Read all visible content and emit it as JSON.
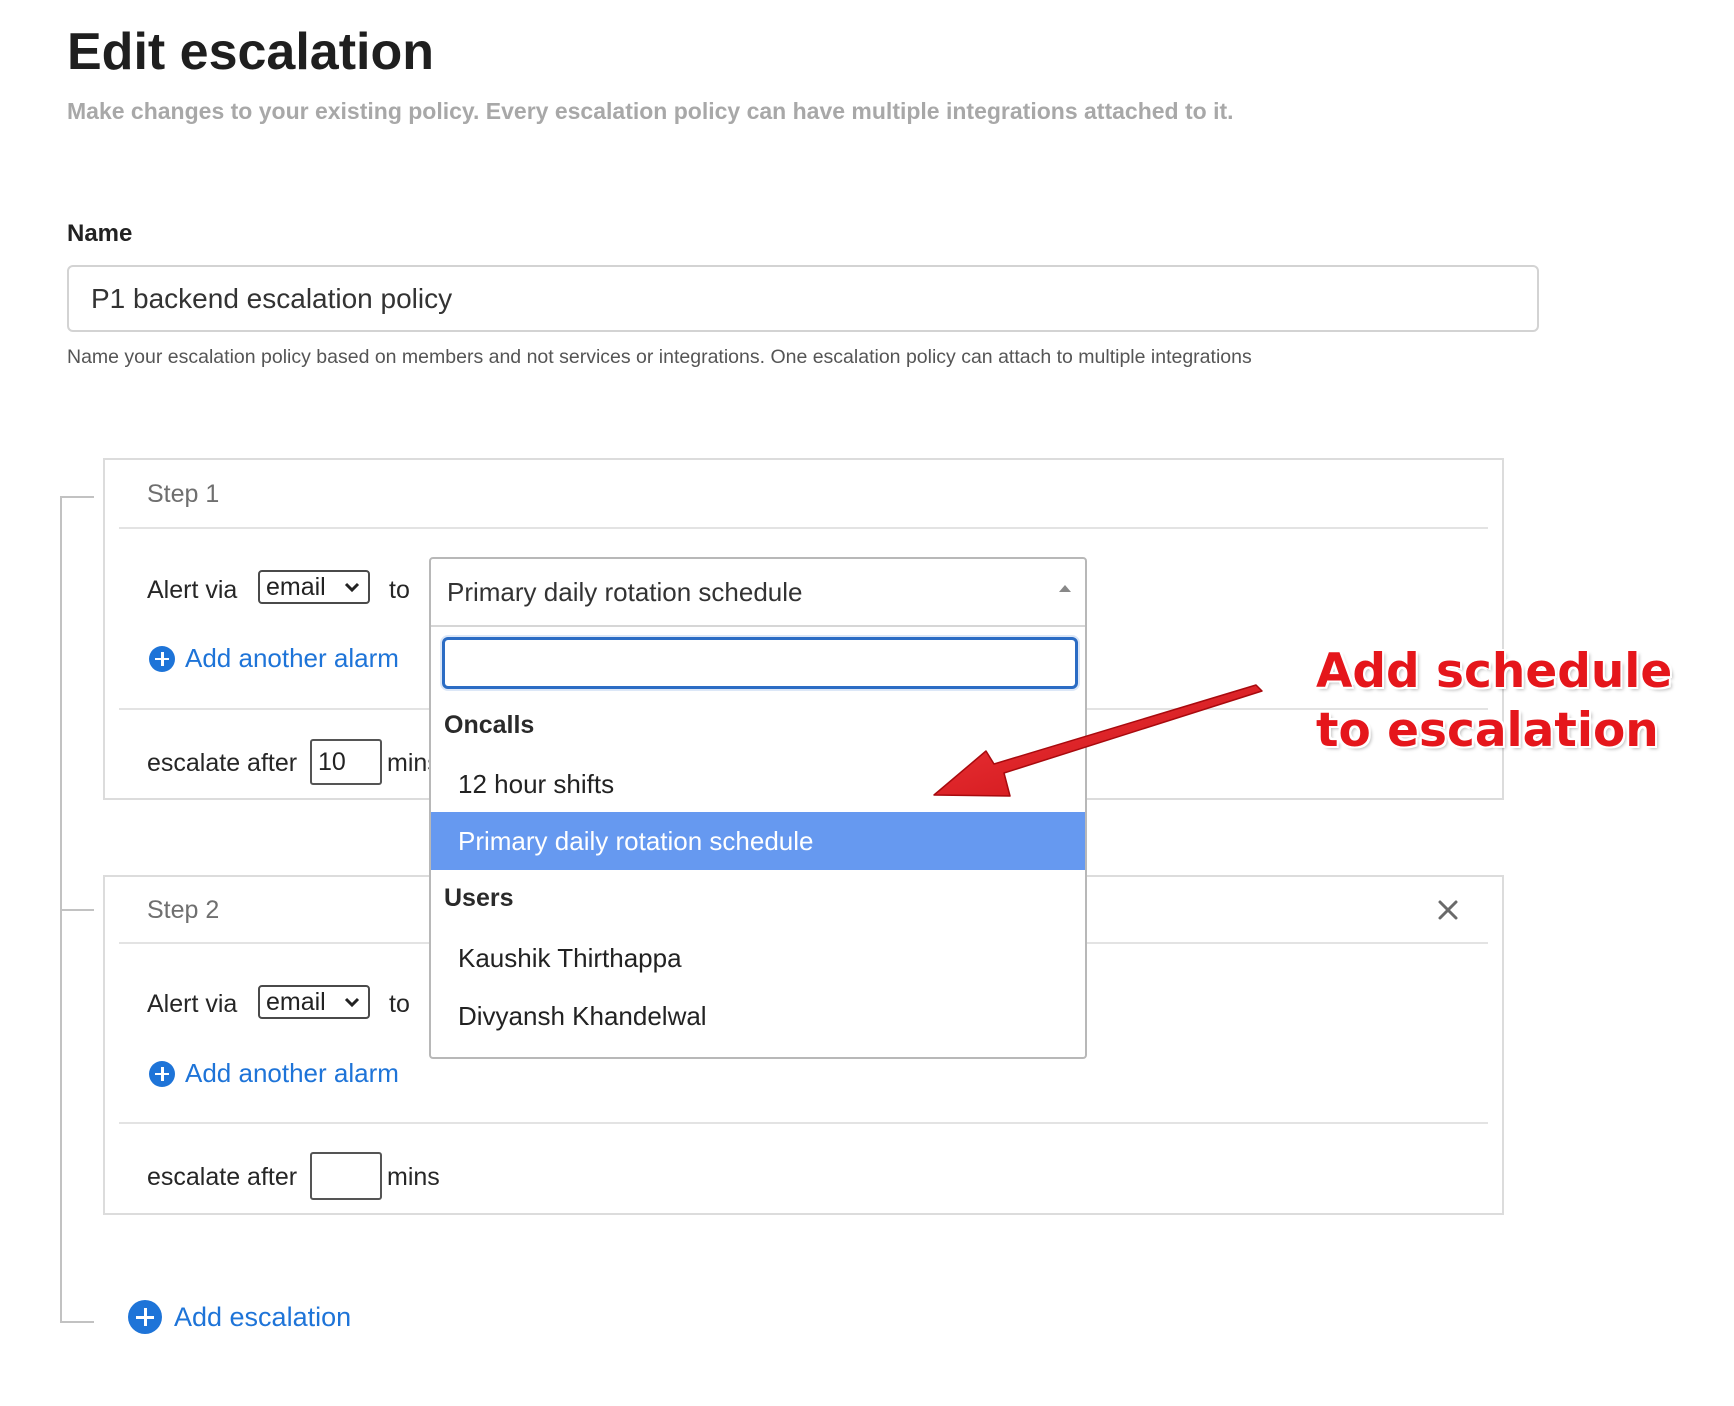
{
  "header": {
    "title": "Edit escalation",
    "subtitle": "Make changes to your existing policy. Every escalation policy can have multiple integrations attached to it."
  },
  "name_field": {
    "label": "Name",
    "value": "P1 backend escalation policy",
    "help": "Name your escalation policy based on members and not services or integrations. One escalation policy can attach to multiple integrations"
  },
  "steps": [
    {
      "title": "Step 1",
      "alert_via_label": "Alert via",
      "channel": "email",
      "to_label": "to",
      "add_alarm_label": "Add another alarm",
      "escalate_label": "escalate after",
      "escalate_value": "10",
      "mins_label": "mins"
    },
    {
      "title": "Step 2",
      "alert_via_label": "Alert via",
      "channel": "email",
      "to_label": "to",
      "add_alarm_label": "Add another alarm",
      "escalate_label": "escalate after",
      "escalate_value": "",
      "mins_label": "mins"
    }
  ],
  "dropdown": {
    "selected": "Primary daily rotation schedule",
    "search_value": "",
    "groups": [
      {
        "label": "Oncalls",
        "options": [
          "12 hour shifts",
          "Primary daily rotation schedule"
        ]
      },
      {
        "label": "Users",
        "options": [
          "Kaushik Thirthappa",
          "Divyansh Khandelwal"
        ]
      }
    ]
  },
  "add_escalation_label": "Add escalation",
  "annotation": {
    "line1": "Add schedule",
    "line2": "to escalation",
    "color": "#e5161b"
  },
  "colors": {
    "link": "#1e74d8",
    "selected_option": "#6699f0"
  }
}
